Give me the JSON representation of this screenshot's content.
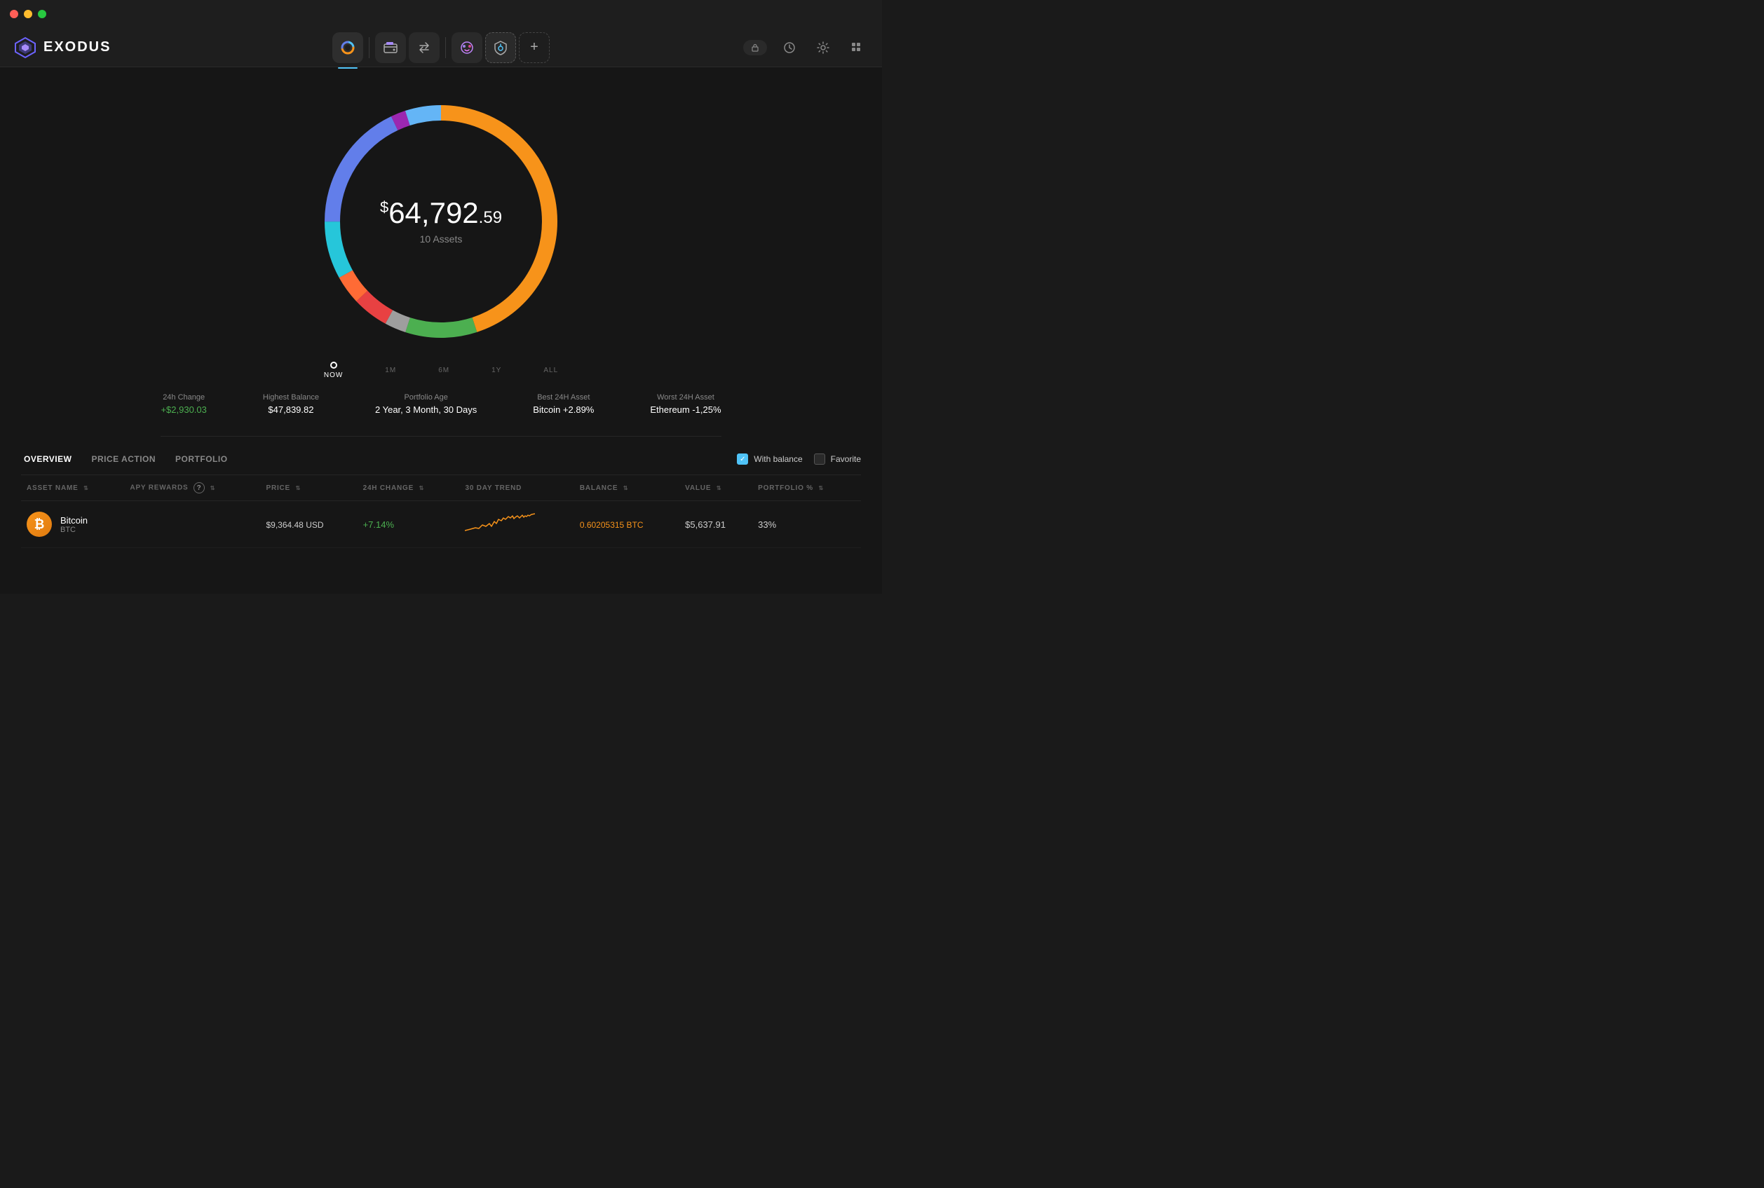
{
  "titleBar": {
    "trafficLights": [
      "red",
      "yellow",
      "green"
    ]
  },
  "header": {
    "logo": {
      "text": "EXODUS",
      "iconColor": "#6c63ff"
    },
    "nav": {
      "items": [
        {
          "id": "portfolio",
          "icon": "⬤",
          "active": true
        },
        {
          "id": "wallet",
          "icon": "🟧",
          "active": false
        },
        {
          "id": "exchange",
          "icon": "⇄",
          "active": false
        },
        {
          "id": "nft",
          "icon": "👾",
          "active": false
        },
        {
          "id": "earn",
          "icon": "🛡",
          "active": false
        }
      ],
      "addLabel": "+",
      "separatorAfter": [
        1,
        3
      ]
    },
    "rightActions": [
      {
        "id": "lock",
        "label": "lock",
        "isToggle": true
      },
      {
        "id": "history",
        "icon": "🕐"
      },
      {
        "id": "settings",
        "icon": "⚙"
      },
      {
        "id": "grid",
        "icon": "⊞"
      }
    ]
  },
  "portfolio": {
    "totalAmount": "64,792",
    "amountPrefix": "$",
    "amountCents": ".59",
    "assetsCount": "10 Assets",
    "timeline": {
      "items": [
        {
          "label": "NOW",
          "active": true,
          "hasDot": true
        },
        {
          "label": "1M",
          "active": false
        },
        {
          "label": "6M",
          "active": false
        },
        {
          "label": "1Y",
          "active": false
        },
        {
          "label": "ALL",
          "active": false
        }
      ]
    },
    "stats": [
      {
        "label": "24h Change",
        "value": "+$2,930.03",
        "type": "positive"
      },
      {
        "label": "Highest Balance",
        "value": "$47,839.82",
        "type": "normal"
      },
      {
        "label": "Portfolio Age",
        "value": "2 Year, 3 Month, 30 Days",
        "type": "normal"
      },
      {
        "label": "Best 24H Asset",
        "value": "Bitcoin +2.89%",
        "type": "normal"
      },
      {
        "label": "Worst 24H Asset",
        "value": "Ethereum -1,25%",
        "type": "normal"
      }
    ],
    "donut": {
      "segments": [
        {
          "color": "#f7931a",
          "percent": 45
        },
        {
          "color": "#627eea",
          "percent": 18
        },
        {
          "color": "#26c6da",
          "percent": 8
        },
        {
          "color": "#e84142",
          "percent": 5
        },
        {
          "color": "#ff6b35",
          "percent": 4
        },
        {
          "color": "#4caf50",
          "percent": 10
        },
        {
          "color": "#9c27b0",
          "percent": 4
        },
        {
          "color": "#78909c",
          "percent": 3
        },
        {
          "color": "#64b5f6",
          "percent": 2
        },
        {
          "color": "#ce93d8",
          "percent": 1
        }
      ]
    }
  },
  "table": {
    "tabs": [
      {
        "label": "OVERVIEW",
        "active": true
      },
      {
        "label": "PRICE ACTION",
        "active": false
      },
      {
        "label": "PORTFOLIO",
        "active": false
      }
    ],
    "filters": [
      {
        "id": "with-balance",
        "label": "With balance",
        "checked": true
      },
      {
        "id": "favorite",
        "label": "Favorite",
        "checked": false
      }
    ],
    "columns": [
      {
        "label": "ASSET NAME",
        "sortable": true
      },
      {
        "label": "APY REWARDS",
        "sortable": true,
        "hasInfo": true
      },
      {
        "label": "PRICE",
        "sortable": true
      },
      {
        "label": "24H CHANGE",
        "sortable": true
      },
      {
        "label": "30 DAY TREND",
        "sortable": false
      },
      {
        "label": "BALANCE",
        "sortable": true
      },
      {
        "label": "VALUE",
        "sortable": true
      },
      {
        "label": "PORTFOLIO %",
        "sortable": true
      }
    ],
    "rows": [
      {
        "icon": "₿",
        "iconBg": "#f7931a",
        "name": "Bitcoin",
        "symbol": "BTC",
        "apyRewards": "",
        "price": "$9,364.48 USD",
        "change24h": "+7.14%",
        "changeType": "positive",
        "balance": "0.60205315 BTC",
        "balanceColor": "#f7931a",
        "value": "$5,637.91",
        "portfolio": "33%"
      }
    ]
  }
}
